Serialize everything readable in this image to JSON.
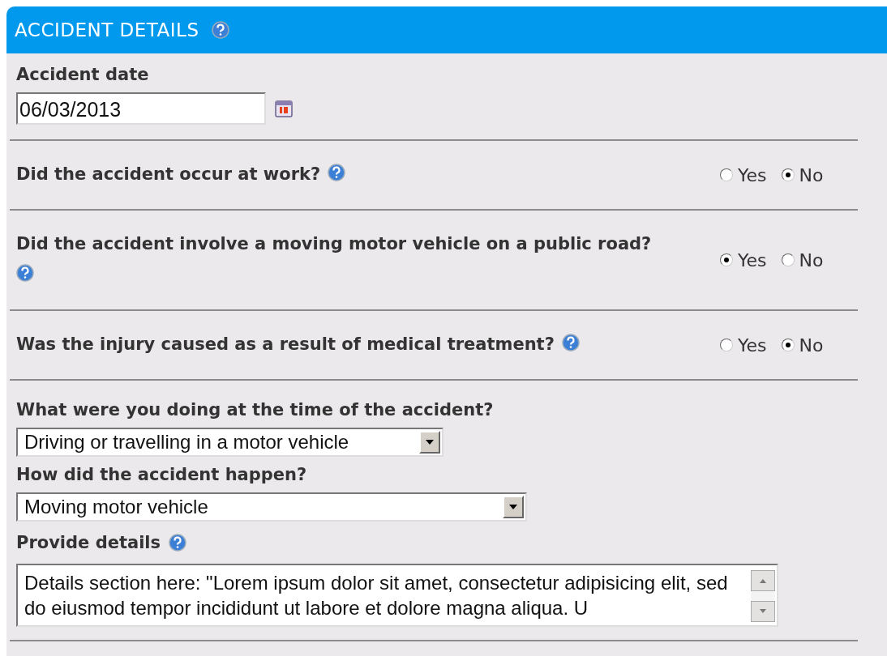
{
  "section": {
    "title": "ACCIDENT DETAILS",
    "help": true
  },
  "fields": [
    {
      "kind": "date",
      "label": "Accident date",
      "help": false,
      "value": "06/03/2013"
    },
    {
      "kind": "yesno",
      "label": "Did the accident occur at work?",
      "help": true,
      "options": [
        {
          "label": "Yes",
          "selected": false
        },
        {
          "label": "No",
          "selected": true
        }
      ]
    },
    {
      "kind": "yesno",
      "label": "Did the accident involve a moving motor vehicle on a public road?",
      "help": true,
      "options": [
        {
          "label": "Yes",
          "selected": true
        },
        {
          "label": "No",
          "selected": false
        }
      ]
    },
    {
      "kind": "yesno",
      "label": "Was the injury caused as a result of medical treatment?",
      "help": true,
      "options": [
        {
          "label": "Yes",
          "selected": false
        },
        {
          "label": "No",
          "selected": true
        }
      ]
    },
    {
      "kind": "select",
      "label": "What were you doing at the time of the accident?",
      "help": false,
      "value": "Driving or travelling in a motor vehicle"
    },
    {
      "kind": "select",
      "label": "How did the accident happen?",
      "help": false,
      "value": "Moving motor vehicle"
    },
    {
      "kind": "textarea",
      "label": "Provide details",
      "help": true,
      "value": "Details section here: \"Lorem ipsum dolor sit amet, consectetur adipisicing elit, sed do eiusmod tempor incididunt ut labore et dolore magna aliqua. U"
    }
  ]
}
